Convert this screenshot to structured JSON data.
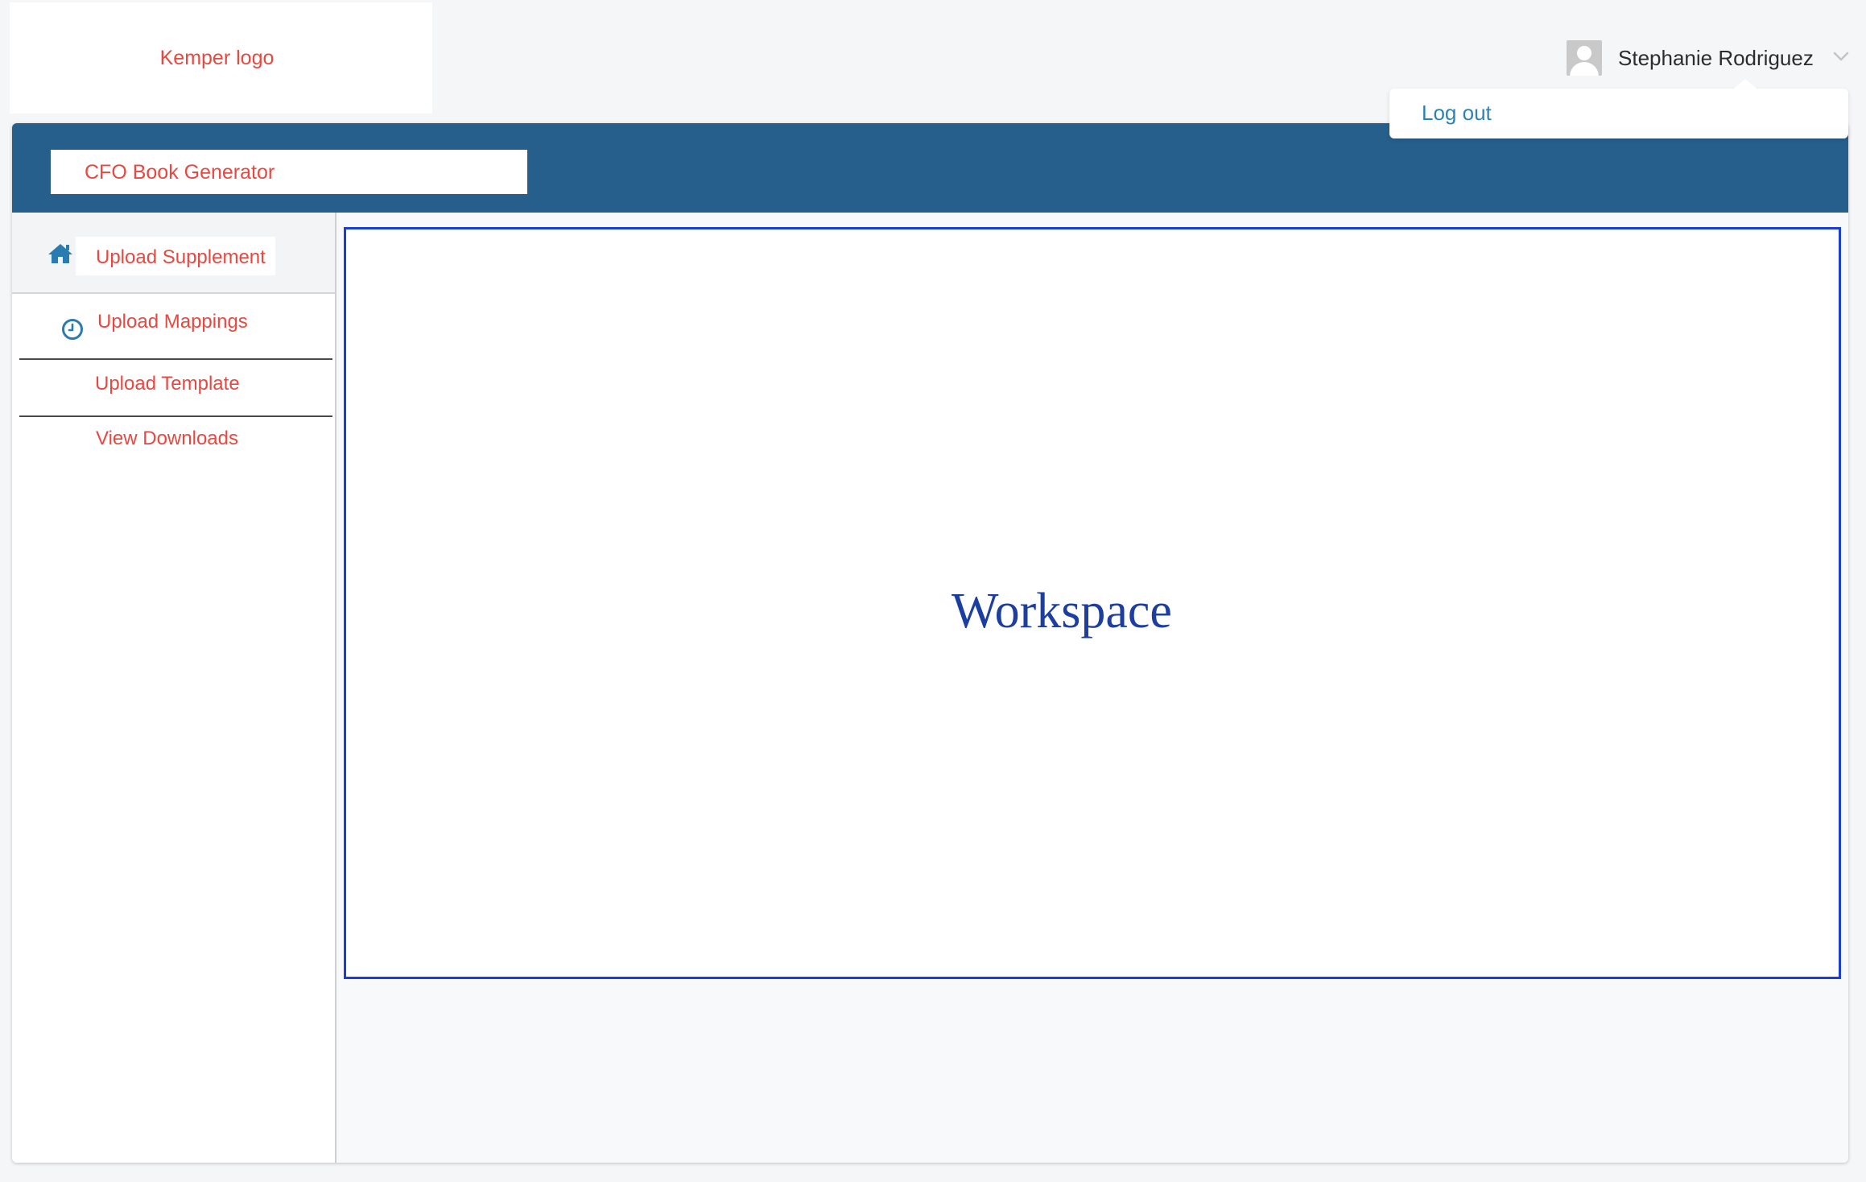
{
  "logo": {
    "text": "Kemper logo"
  },
  "user": {
    "name": "Stephanie Rodriguez",
    "avatar_icon": "user-avatar-icon",
    "menu_icon": "chevron-down-icon",
    "menu": {
      "logout_label": "Log out"
    }
  },
  "header": {
    "title": "CFO Book Generator"
  },
  "sidebar": {
    "items": [
      {
        "label": "Upload Supplement",
        "icon": "home-icon"
      },
      {
        "label": "Upload Mappings",
        "icon": "clock-icon"
      },
      {
        "label": "Upload Template"
      },
      {
        "label": "View Downloads"
      }
    ]
  },
  "main": {
    "workspace_label": "Workspace"
  },
  "colors": {
    "accent": "#265f8c",
    "link_red": "#e8483f",
    "link_blue": "#2c83b8",
    "workspace_border": "#1a3fd6"
  }
}
